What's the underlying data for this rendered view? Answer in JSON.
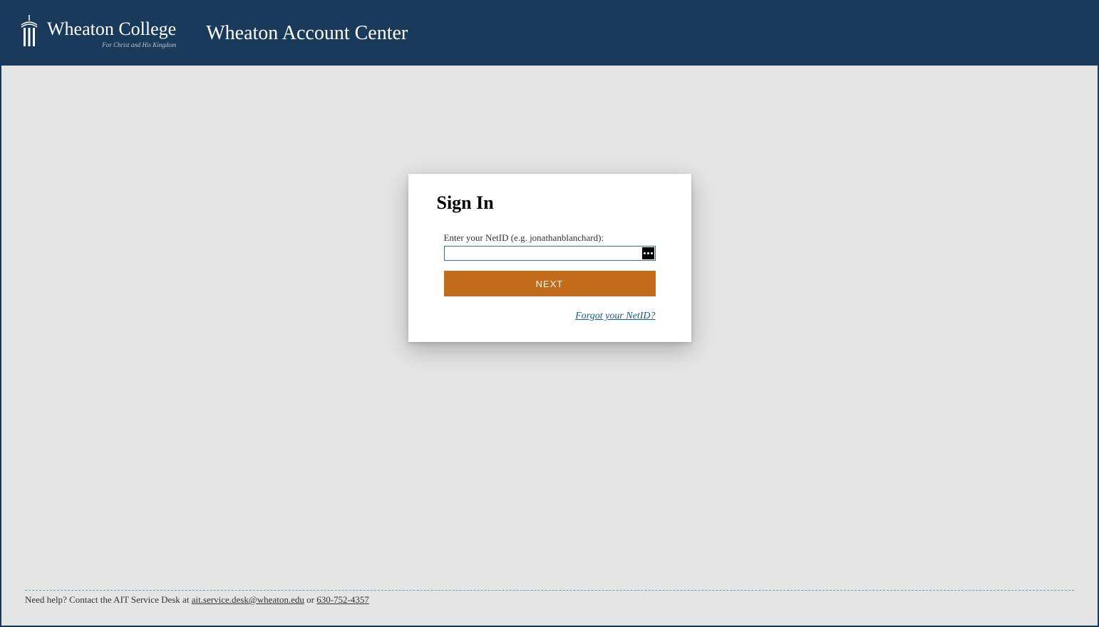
{
  "header": {
    "college_name": "Wheaton College",
    "tagline": "For Christ and His Kingdom",
    "app_title": "Wheaton Account Center"
  },
  "signin": {
    "title": "Sign In",
    "label": "Enter your NetID (e.g. jonathanblanchard):",
    "input_value": "",
    "next_button": "NEXT",
    "forgot_link": "Forgot your NetID?"
  },
  "footer": {
    "help_prefix": "Need help? Contact the AIT Service Desk at ",
    "email": "ait.service.desk@wheaton.edu",
    "help_middle": " or ",
    "phone": "630-752-4357"
  }
}
